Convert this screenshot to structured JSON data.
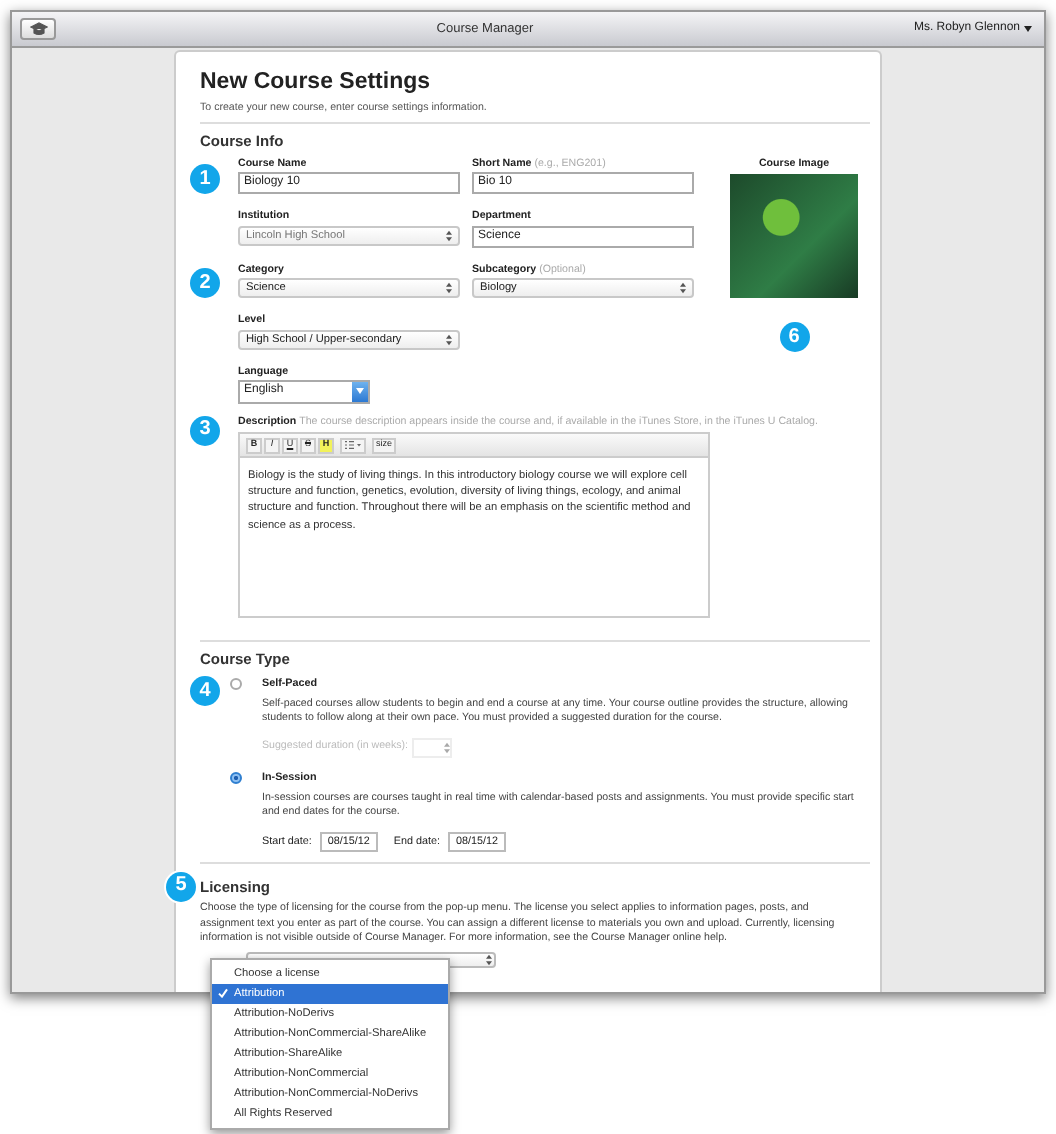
{
  "window": {
    "title": "Course Manager",
    "user": "Ms. Robyn Glennon"
  },
  "page": {
    "title": "New Course Settings",
    "subtitle": "To create your new course, enter course settings information."
  },
  "course_info": {
    "heading": "Course Info",
    "image_label": "Course Image",
    "image_step": "6",
    "rows": [
      {
        "step": "1",
        "fields": [
          {
            "kind": "text",
            "label": "Course Name",
            "value": "Biology 10",
            "disabled": false
          },
          {
            "kind": "text",
            "label": "Short Name",
            "hint": "(e.g., ENG201)",
            "value": "Bio 10",
            "disabled": false
          }
        ]
      },
      {
        "fields": [
          {
            "kind": "select",
            "label": "Institution",
            "value": "Lincoln High School",
            "disabled": true
          },
          {
            "kind": "text",
            "label": "Department",
            "value": "Science",
            "disabled": false
          }
        ]
      },
      {
        "step": "2",
        "fields": [
          {
            "kind": "select",
            "label": "Category",
            "value": "Science",
            "disabled": false
          },
          {
            "kind": "select",
            "label": "Subcategory",
            "hint": "(Optional)",
            "value": "Biology",
            "disabled": false
          }
        ]
      },
      {
        "fields": [
          {
            "kind": "select",
            "label": "Level",
            "value": "High School / Upper-secondary",
            "disabled": false
          }
        ]
      },
      {
        "fields": [
          {
            "kind": "combo",
            "label": "Language",
            "value": "English",
            "disabled": false
          }
        ]
      }
    ],
    "description": {
      "step": "3",
      "label": "Description",
      "hint": "The course description appears inside the course and, if available in the iTunes Store, in the iTunes U Catalog.",
      "toolbar": [
        {
          "kind": "bold",
          "label": "B"
        },
        {
          "kind": "italic",
          "label": "I"
        },
        {
          "kind": "underline",
          "label": "U"
        },
        {
          "kind": "strike",
          "label": "S"
        },
        {
          "kind": "highlight",
          "label": "H"
        },
        {
          "kind": "list"
        },
        {
          "kind": "size",
          "label": "size"
        }
      ],
      "text": "Biology is the study of living things. In this introductory biology course we will explore cell structure and function, genetics, evolution, diversity of living things, ecology, and animal structure and function. Throughout there will be an emphasis on the scientific method and science as a process."
    }
  },
  "course_type": {
    "heading": "Course Type",
    "step": "4",
    "options": [
      {
        "kind": "duration",
        "label": "Self-Paced",
        "selected": false,
        "description": "Self-paced courses allow students to begin and end a course at any time. Your course outline provides the structure, allowing students to follow along at their own pace. You must provided a suggested duration for the course.",
        "duration_label": "Suggested duration (in weeks):"
      },
      {
        "kind": "dates",
        "label": "In-Session",
        "selected": true,
        "description": "In-session courses are courses taught in real time with calendar-based posts and assignments. You must provide specific start and end dates for the course.",
        "start_label": "Start date:",
        "start": "08/15/12",
        "end_label": "End date:",
        "end": "08/15/12"
      }
    ]
  },
  "licensing": {
    "heading": "Licensing",
    "step": "5",
    "description": "Choose the type of licensing for the course from the pop-up menu. The license you select applies to information pages, posts, and assignment text you enter as part of the course. You can assign a different license to materials you own and upload. Currently, licensing information is not visible outside of Course Manager. For more information, see the Course Manager online help.",
    "menu": [
      {
        "label": "Choose a license",
        "selected": false
      },
      {
        "label": "Attribution",
        "selected": true
      },
      {
        "label": "Attribution-NoDerivs",
        "selected": false
      },
      {
        "label": "Attribution-NonCommercial-ShareAlike",
        "selected": false
      },
      {
        "label": "Attribution-ShareAlike",
        "selected": false
      },
      {
        "label": "Attribution-NonCommercial",
        "selected": false
      },
      {
        "label": "Attribution-NonCommercial-NoDerivs",
        "selected": false
      },
      {
        "label": "All Rights Reserved",
        "selected": false
      }
    ]
  }
}
